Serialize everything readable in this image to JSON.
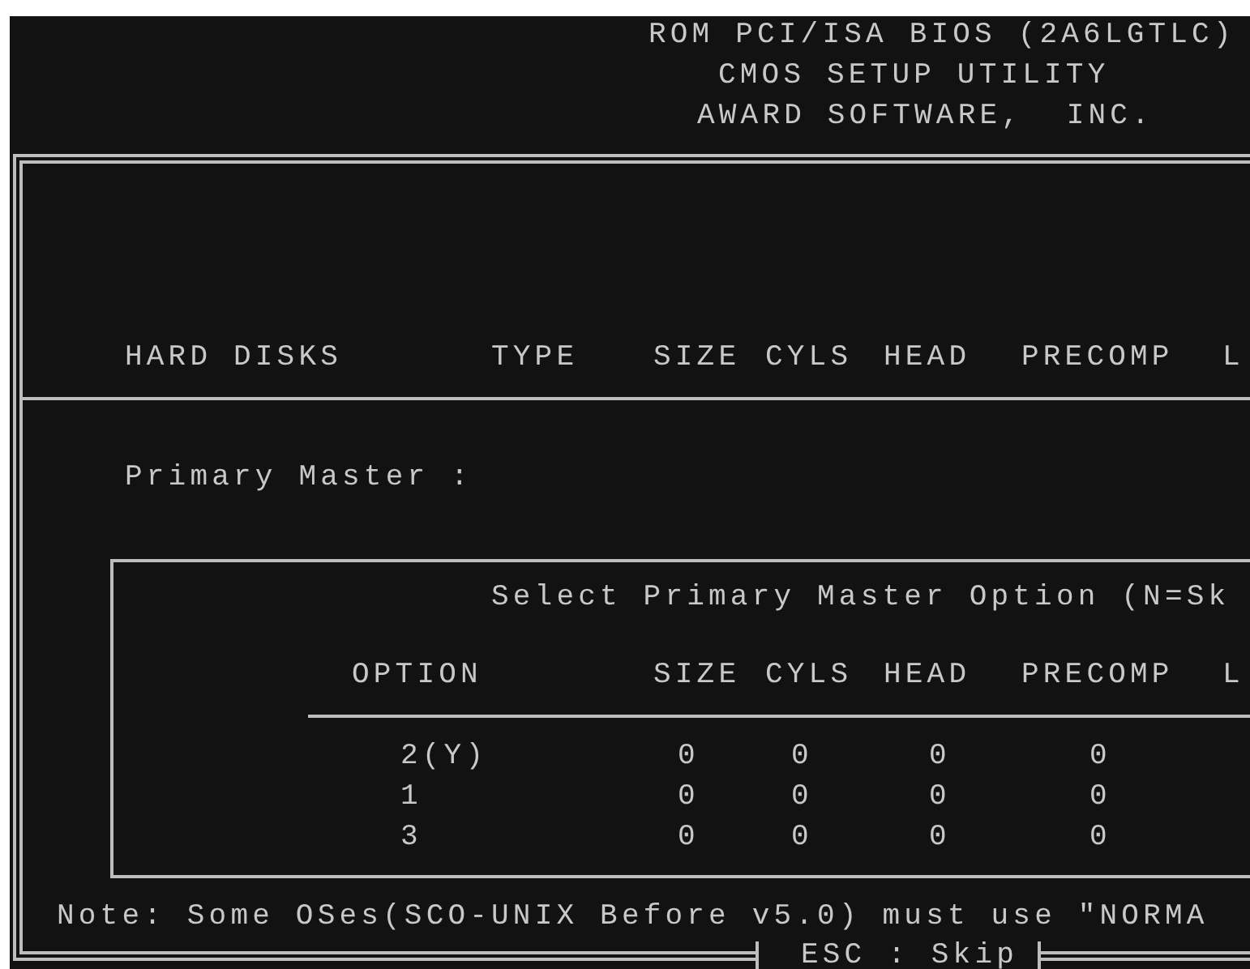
{
  "header": {
    "lines": [
      "ROM PCI/ISA BIOS (2A6LGTLC)",
      "CMOS SETUP UTILITY",
      "AWARD SOFTWARE,  INC."
    ]
  },
  "hard_disks": {
    "columns": [
      "HARD DISKS",
      "TYPE",
      "SIZE",
      "CYLS",
      "HEAD",
      "PRECOMP",
      "L"
    ],
    "primary_master_label": "Primary Master :"
  },
  "option_dialog": {
    "title": "Select Primary Master Option (N=Sk",
    "columns": [
      "OPTION",
      "SIZE",
      "CYLS",
      "HEAD",
      "PRECOMP",
      "L"
    ],
    "rows": [
      {
        "option": "2(Y)",
        "size": "0",
        "cyls": "0",
        "head": "0",
        "precomp": "0"
      },
      {
        "option": "1",
        "size": "0",
        "cyls": "0",
        "head": "0",
        "precomp": "0"
      },
      {
        "option": "3",
        "size": "0",
        "cyls": "0",
        "head": "0",
        "precomp": "0"
      }
    ]
  },
  "note": "Note: Some OSes(SCO-UNIX Before v5.0) must use \"NORMA",
  "footer_key": "ESC : Skip"
}
